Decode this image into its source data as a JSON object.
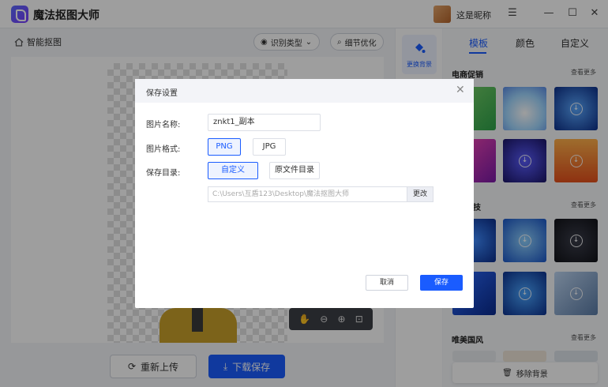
{
  "app": {
    "title": "魔法抠图大师",
    "username": "这是昵称"
  },
  "window": {
    "menu_icon": "menu-icon",
    "min_icon": "minimize-icon",
    "max_icon": "maximize-icon",
    "close_icon": "close-icon"
  },
  "toolbar": {
    "home_label": "智能抠图",
    "recognize_label": "识别类型",
    "detail_label": "细节优化"
  },
  "canvas": {
    "reupload_label": "重新上传",
    "download_label": "下载保存"
  },
  "side": {
    "change_bg_label": "更换背景"
  },
  "right": {
    "tabs": [
      "模板",
      "颜色",
      "自定义"
    ],
    "active_tab": "模板",
    "sections": [
      {
        "title": "电商促销",
        "more": "查看更多"
      },
      {
        "title": "技",
        "more": "查看更多"
      },
      {
        "title": "唯美国风",
        "more": "查看更多"
      }
    ],
    "remove_bg_label": "移除背景"
  },
  "dialog": {
    "title": "保存设置",
    "name_label": "图片名称:",
    "name_value": "znkt1_副本",
    "format_label": "图片格式:",
    "format_options": [
      "PNG",
      "JPG"
    ],
    "format_selected": "PNG",
    "dir_label": "保存目录:",
    "dir_options": [
      "自定义",
      "原文件目录"
    ],
    "dir_selected": "自定义",
    "path_value": "C:\\Users\\互盾123\\Desktop\\魔法抠图大师",
    "change_label": "更改",
    "cancel_label": "取消",
    "save_label": "保存"
  },
  "colors": {
    "accent": "#1a5cff"
  }
}
